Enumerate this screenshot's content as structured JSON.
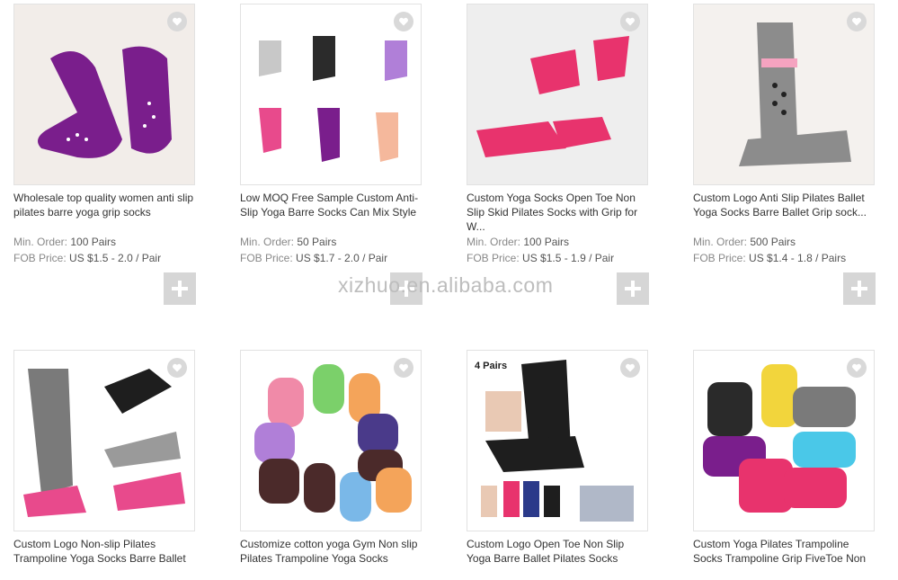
{
  "watermark": "xizhuo.en.alibaba.com",
  "labels": {
    "min_order": "Min. Order:",
    "fob_price": "FOB Price:"
  },
  "products": [
    {
      "title": "Wholesale top quality women anti slip pilates barre yoga grip socks",
      "min_order": "100 Pairs",
      "fob_price": "US $1.5 - 2.0 / Pair",
      "sock_color": "#7a1e8c"
    },
    {
      "title": "Low MOQ Free Sample Custom Anti-Slip Yoga Barre Socks Can Mix Style",
      "min_order": "50 Pairs",
      "fob_price": "US $1.7 - 2.0 / Pair",
      "sock_color": "#2b2b2b"
    },
    {
      "title": "Custom Yoga Socks Open Toe Non Slip Skid Pilates Socks with Grip for W...",
      "min_order": "100 Pairs",
      "fob_price": "US $1.5 - 1.9 / Pair",
      "sock_color": "#e8336d"
    },
    {
      "title": "Custom Logo Anti Slip Pilates Ballet Yoga Socks Barre Ballet Grip sock...",
      "min_order": "500 Pairs",
      "fob_price": "US $1.4 - 1.8 / Pairs",
      "sock_color": "#8c8c8c"
    },
    {
      "title": "Custom Logo Non-slip Pilates Trampoline Yoga Socks Barre Ballet",
      "sock_color": "#e84a8c"
    },
    {
      "title": "Customize cotton yoga Gym Non slip Pilates Trampoline Yoga Socks",
      "sock_color": "#f08aa8"
    },
    {
      "title": "Custom Logo Open Toe Non Slip Yoga Barre Ballet Pilates Socks",
      "sock_color": "#1e1e1e",
      "badge": "4 Pairs"
    },
    {
      "title": "Custom Yoga Pilates Trampoline Socks Trampoline Grip FiveToe Non",
      "sock_color": "#e8336d"
    }
  ]
}
